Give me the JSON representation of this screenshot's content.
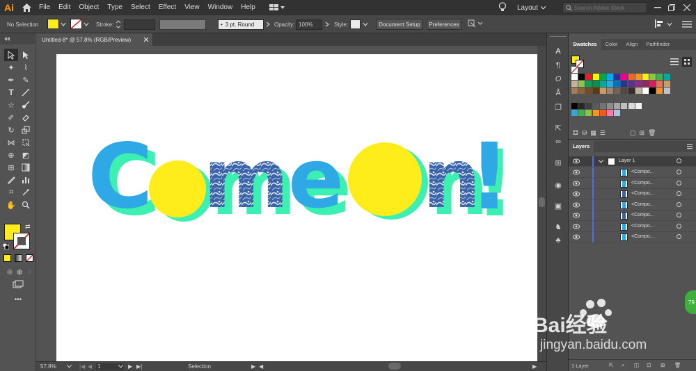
{
  "app": {
    "logo": "Ai",
    "menu": [
      "File",
      "Edit",
      "Object",
      "Type",
      "Select",
      "Effect",
      "View",
      "Window",
      "Help"
    ],
    "workspace": "Layout",
    "search_placeholder": "Search Adobe Stock"
  },
  "controlbar": {
    "selection": "No Selection",
    "stroke_label": "Stroke:",
    "brush": "3 pt. Round",
    "opacity_label": "Opacity:",
    "opacity": "100%",
    "style_label": "Style:",
    "document_setup": "Document Setup",
    "preferences": "Preferences"
  },
  "document": {
    "tab": "Untitled-8* @ 57.8% (RGB/Preview)",
    "artwork_letters": [
      "C",
      "m",
      "e",
      "n",
      "!"
    ]
  },
  "statusbar": {
    "zoom": "57.8%",
    "artboard": "1",
    "tool": "Selection"
  },
  "swatches": {
    "tabs": [
      "Swatches",
      "Color",
      "Align",
      "Pathfinder"
    ],
    "rows": [
      [
        "#ffffff",
        "#000000",
        "#ed1c24",
        "#fff200",
        "#00a651",
        "#00aeef",
        "#2e3192",
        "#ec008c",
        "#f26522",
        "#f7941d",
        "#fff200",
        "#8dc63f",
        "#39b54a",
        "#00a99d"
      ],
      [
        "#c7b299",
        "#8dc63f",
        "#00a651",
        "#009444",
        "#00a99d",
        "#27aae1",
        "#0072bc",
        "#2e3192",
        "#662d91",
        "#92278f",
        "#9e1f63",
        "#ed145b",
        "#f26c4f",
        "#c69c6d"
      ],
      [
        "#a67c52",
        "#8c6239",
        "#754c24",
        "#603913",
        "#c69c6d",
        "#998675",
        "#736357",
        "#534741",
        "#362f2d",
        "#c7b299",
        "#ffffff",
        "#000000",
        "#f7941d",
        "#c2c2c2"
      ],
      [
        "#000000",
        "#262626",
        "#404040",
        "#595959",
        "#737373",
        "#8c8c8c",
        "#a6a6a6",
        "#bfbfbf",
        "#d9d9d9",
        "#f2f2f2"
      ],
      [
        "#29abe2",
        "#39b54a",
        "#8cc63f",
        "#f7931e",
        "#f15a24",
        "#ff7bac",
        "#a9c5e0"
      ]
    ]
  },
  "layers": {
    "tab": "Layers",
    "top_layer": "Layer 1",
    "sublayers": [
      "<Compo...",
      "<Compo...",
      "<Compo...",
      "<Compo...",
      "<Compo...",
      "<Compo...",
      "<Compo..."
    ],
    "count": "1 Layer"
  },
  "watermark": {
    "text": "jingyan.baidu.com",
    "logo": "Bai经验"
  },
  "badge": "79"
}
